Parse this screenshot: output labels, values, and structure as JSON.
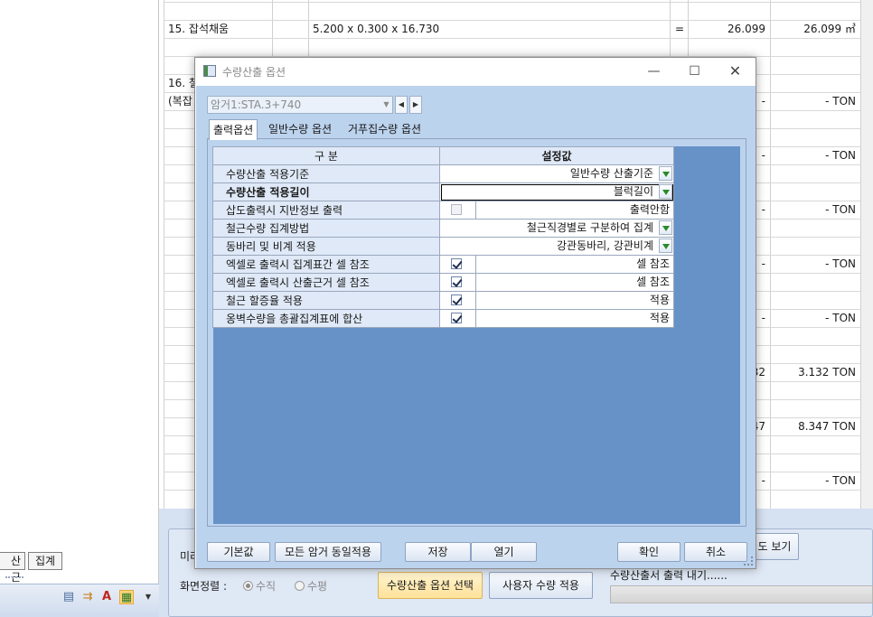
{
  "background": {
    "left_tabs": [
      "산근",
      "집계"
    ],
    "rows": [
      {
        "label": "15. 잡석채움",
        "expr": "5.200 x 0.300 x 16.730",
        "eq": "=",
        "value": "26.099",
        "total": "26.099 ㎥"
      },
      {
        "label": "16. 철",
        "expr": "",
        "eq": "",
        "value": "",
        "total": ""
      },
      {
        "label": "(복잡",
        "expr": "",
        "eq": "",
        "value": "-",
        "total": "- TON"
      },
      {
        "label": "",
        "expr": "",
        "eq": "",
        "value": "-",
        "total": "- TON"
      },
      {
        "label": "",
        "expr": "",
        "eq": "",
        "value": "-",
        "total": "- TON"
      },
      {
        "label": "",
        "expr": "",
        "eq": "",
        "value": "-",
        "total": "- TON"
      },
      {
        "label": "",
        "expr": "",
        "eq": "",
        "value": "-",
        "total": "- TON"
      },
      {
        "label": "",
        "expr": "",
        "eq": "",
        "value": "32",
        "total": "3.132 TON"
      },
      {
        "label": "",
        "expr": "",
        "eq": "",
        "value": "47",
        "total": "8.347 TON"
      },
      {
        "label": "",
        "expr": "",
        "eq": "",
        "value": "-",
        "total": "- TON"
      }
    ],
    "bottom": {
      "preview_label": "미리",
      "align_label": "화면정렬 :",
      "align_options": [
        {
          "label": "수직",
          "selected": true
        },
        {
          "label": "수평",
          "selected": false
        }
      ],
      "option_button": "수량산출 옵션 선택",
      "user_qty_button": "사용자 수량 적용",
      "view_button": "도 보기",
      "export_status": "수량산출서 출력 내기......",
      "progress": 0
    }
  },
  "dialog": {
    "title": "수량산출 옵션",
    "combo_value": "암거1:STA.3+740",
    "tabs": [
      {
        "label": "출력옵션",
        "active": true
      },
      {
        "label": "일반수량 옵션",
        "active": false
      },
      {
        "label": "거푸집수량 옵션",
        "active": false
      }
    ],
    "grid": {
      "header": {
        "col1": "구 분",
        "col2": "설정값"
      },
      "rows": [
        {
          "label": "수량산출 적용기준",
          "value": "일반수량 산출기준",
          "kind": "dropdown"
        },
        {
          "label": "수량산출 적용길이",
          "value": "블럭길이",
          "kind": "dropdown",
          "bold": true,
          "focused": true
        },
        {
          "label": "삽도출력시 지반정보 출력",
          "value": "출력안함",
          "kind": "check",
          "checked": false
        },
        {
          "label": "철근수량 집계방법",
          "value": "철근직경별로 구분하여 집계",
          "kind": "dropdown"
        },
        {
          "label": "동바리 및 비계 적용",
          "value": "강관동바리, 강관비계",
          "kind": "dropdown"
        },
        {
          "label": "엑셀로 출력시 집계표간 셀 참조",
          "value": "셀 참조",
          "kind": "check",
          "checked": true
        },
        {
          "label": "엑셀로 출력시 산출근거 셀 참조",
          "value": "셀 참조",
          "kind": "check",
          "checked": true
        },
        {
          "label": "철근 할증율 적용",
          "value": "적용",
          "kind": "check",
          "checked": true
        },
        {
          "label": "옹벽수량을 총괄집계표에 합산",
          "value": "적용",
          "kind": "check",
          "checked": true
        }
      ]
    },
    "buttons": {
      "default": "기본값",
      "apply_all": "모든 암거 동일적용",
      "save": "저장",
      "open": "열기",
      "ok": "확인",
      "cancel": "취소"
    },
    "colors": {
      "grid_background": "#6792c8",
      "dialog_body": "#bcd3ee",
      "dropdown_arrow": "#2a8a2a"
    }
  }
}
